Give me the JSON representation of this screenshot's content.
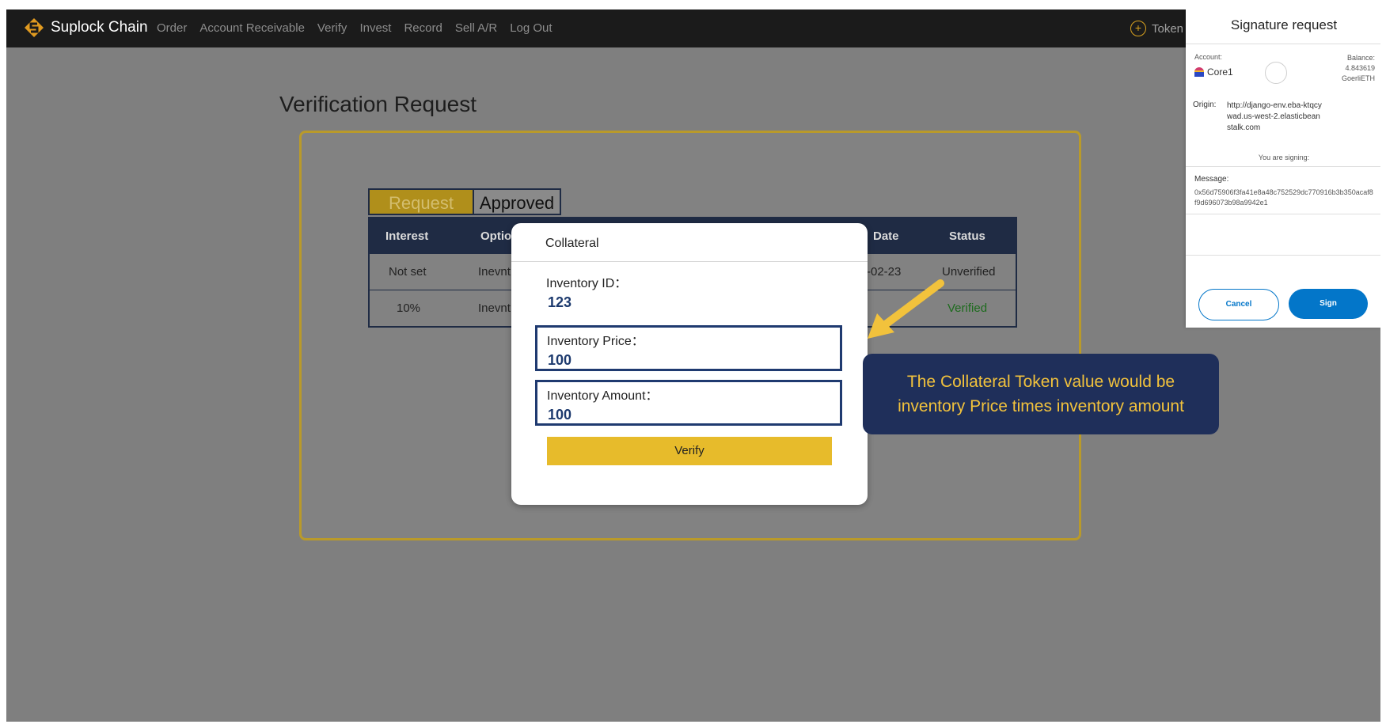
{
  "navbar": {
    "brand": "Suplock Chain",
    "links": [
      "Order",
      "Account Receivable",
      "Verify",
      "Invest",
      "Record",
      "Sell A/R",
      "Log Out"
    ],
    "token_label": "Token"
  },
  "page": {
    "title": "Verification Request"
  },
  "tabs": {
    "request": "Request",
    "approved": "Approved"
  },
  "table": {
    "headers": [
      "Interest",
      "Option",
      "Date",
      "Status"
    ],
    "rows": [
      {
        "interest": "Not set",
        "option": "Inevnt",
        "date": "-02-23",
        "status": "Unverified"
      },
      {
        "interest": "10%",
        "option": "Inevnt",
        "date": "",
        "status": "Verified"
      }
    ]
  },
  "modal": {
    "title": "Collateral",
    "fields": [
      {
        "label": "Inventory ID：",
        "value": "123"
      },
      {
        "label": "Inventory Price：",
        "value": "100"
      },
      {
        "label": "Inventory Amount：",
        "value": "100"
      }
    ],
    "verify_label": "Verify"
  },
  "callout": {
    "line1": "The Collateral Token value would be",
    "line2": "inventory Price times inventory amount"
  },
  "metamask": {
    "title": "Signature request",
    "account_label": "Account:",
    "account_name": "Core1",
    "balance_label": "Balance:",
    "balance_value": "4.843619",
    "balance_unit": "GoerliETH",
    "origin_label": "Origin:",
    "origin_value": "http://django-env.eba-ktqcywad.us-west-2.elasticbeanstalk.com",
    "signing_text": "You are signing:",
    "message_label": "Message:",
    "message_value": "0x56d75906f3fa41e8a48c752529dc770916b3b350acaf8f9d696073b98a9942e1",
    "cancel_label": "Cancel",
    "sign_label": "Sign"
  },
  "colors": {
    "accent_yellow": "#e7bb2b",
    "navy": "#1f2b44",
    "verified_green": "#1d6b1d",
    "metamask_blue": "#0376c9"
  }
}
